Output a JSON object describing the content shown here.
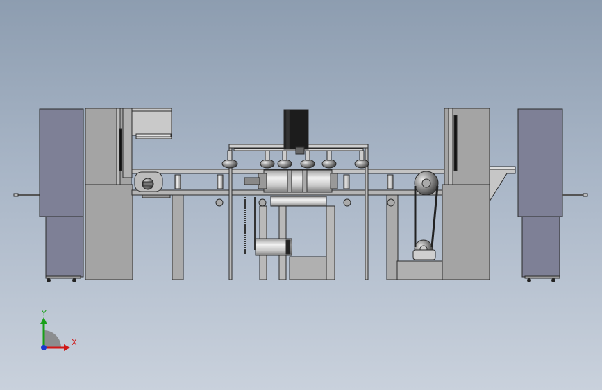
{
  "colors": {
    "background_top": "#8d9db0",
    "background_bottom": "#c9d1dc",
    "frame_gray": "#a6a6a6",
    "cabinet_slate": "#7d7f96",
    "motor_black": "#1c1c1c",
    "roller_silver": "#d2d2d2",
    "outline": "#2b2b2b",
    "axis_x": "#d01818",
    "axis_y": "#18a018",
    "axis_z": "#1838d0"
  },
  "triad": {
    "x_label": "X",
    "y_label": "Y"
  }
}
